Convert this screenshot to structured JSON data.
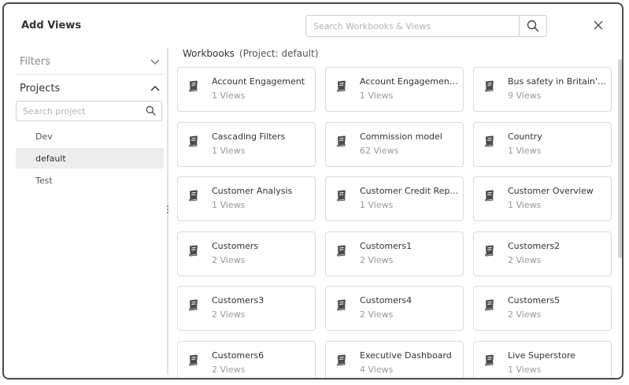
{
  "dialog": {
    "title": "Add Views",
    "search_placeholder": "Search Workbooks & Views"
  },
  "sidebar": {
    "filters_label": "Filters",
    "projects_label": "Projects",
    "project_search_placeholder": "Search project",
    "projects": [
      {
        "label": "Dev",
        "selected": false
      },
      {
        "label": "default",
        "selected": true
      },
      {
        "label": "Test",
        "selected": false
      }
    ]
  },
  "main": {
    "header": "Workbooks",
    "project_note": "(Project: default)",
    "workbooks": [
      {
        "name": "Account Engagement",
        "views": "1 Views"
      },
      {
        "name": "Account Engagement...",
        "views": "1 Views"
      },
      {
        "name": "Bus safety in Britain's ...",
        "views": "9 Views"
      },
      {
        "name": "Cascading Filters",
        "views": "1 Views"
      },
      {
        "name": "Commission model",
        "views": "62 Views"
      },
      {
        "name": "Country",
        "views": "1 Views"
      },
      {
        "name": "Customer Analysis",
        "views": "1 Views"
      },
      {
        "name": "Customer Credit Rep...",
        "views": "1 Views"
      },
      {
        "name": "Customer Overview",
        "views": "1 Views"
      },
      {
        "name": "Customers",
        "views": "2 Views"
      },
      {
        "name": "Customers1",
        "views": "2 Views"
      },
      {
        "name": "Customers2",
        "views": "2 Views"
      },
      {
        "name": "Customers3",
        "views": "2 Views"
      },
      {
        "name": "Customers4",
        "views": "2 Views"
      },
      {
        "name": "Customers5",
        "views": "2 Views"
      },
      {
        "name": "Customers6",
        "views": "2 Views"
      },
      {
        "name": "Executive Dashboard",
        "views": "4 Views"
      },
      {
        "name": "Live Superstore",
        "views": "1 Views"
      }
    ]
  },
  "icons": {
    "search": "search-icon",
    "close": "close-icon",
    "filters_toggle": "chevron-down-icon",
    "projects_toggle": "chevron-up-icon",
    "workbook": "book-icon"
  }
}
